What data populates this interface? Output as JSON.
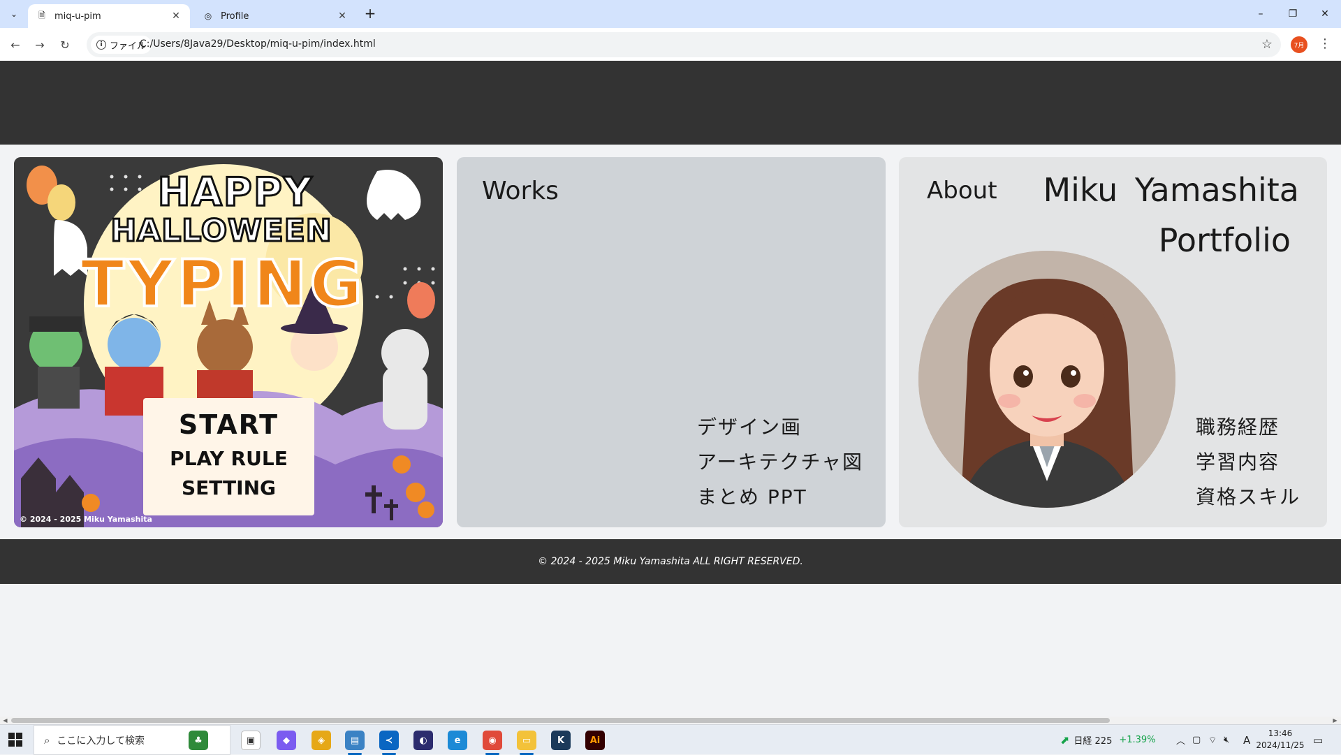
{
  "browser": {
    "tabs": [
      {
        "title": "miq-u-pim",
        "active": true
      },
      {
        "title": "Profile",
        "active": false
      }
    ],
    "new_tab": "+",
    "site_chip": "ファイル",
    "url": "C:/Users/8Java29/Desktop/miq-u-pim/index.html",
    "profile_badge": "7月",
    "window_controls": {
      "minimize": "–",
      "restore": "❐",
      "close": "✕"
    }
  },
  "page": {
    "game_card": {
      "happy": "HAPPY",
      "halloween": "HALLOWEEN",
      "typing": "TYPING",
      "menu": [
        "START",
        "PLAY RULE",
        "SETTING"
      ],
      "copyright": "© 2024 - 2025 Miku Yamashita"
    },
    "works": {
      "heading": "Works",
      "links": [
        "デザイン画",
        "アーキテクチャ図",
        "まとめ PPT"
      ]
    },
    "about": {
      "heading": "About",
      "name": "Miku  Yamashita",
      "subtitle": "Portfolio",
      "links": [
        "職務経歴",
        "学習内容",
        "資格スキル"
      ]
    },
    "footer": "© 2024 - 2025 Miku Yamashita ALL RIGHT RESERVED."
  },
  "taskbar": {
    "search_placeholder": "ここに入力して検索",
    "stock_label": "日経 225",
    "stock_change": "+1.39%",
    "ime": "A",
    "time": "13:46",
    "date": "2024/11/25"
  },
  "colors": {
    "header_footer": "#333333",
    "works_bg": "#cfd3d7",
    "about_bg": "#e3e4e5",
    "typing_orange": "#f0861a",
    "stock_green": "#16a34a"
  }
}
